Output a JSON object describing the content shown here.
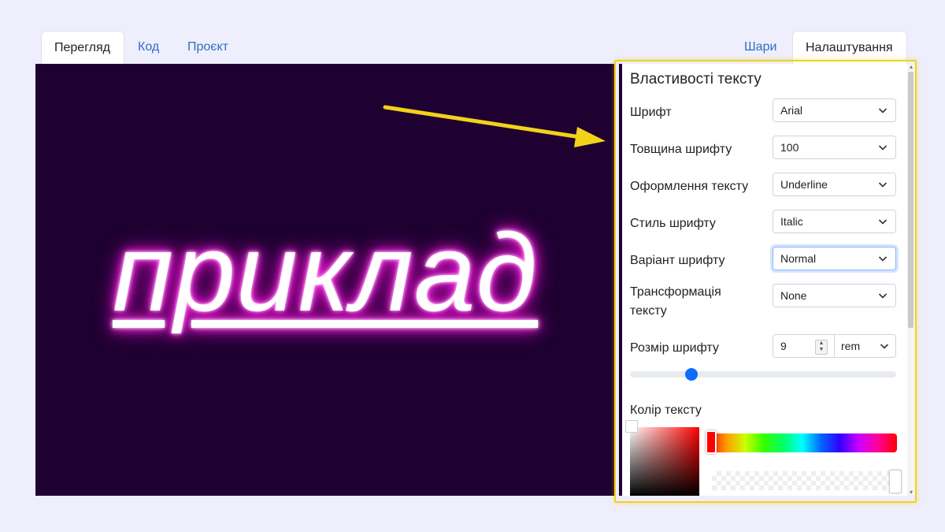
{
  "tabs_left": [
    {
      "label": "Перегляд",
      "active": true
    },
    {
      "label": "Код",
      "active": false
    },
    {
      "label": "Проєкт",
      "active": false
    }
  ],
  "tabs_right": [
    {
      "label": "Шари",
      "active": false
    },
    {
      "label": "Налаштування",
      "active": true
    }
  ],
  "preview": {
    "text": "приклад",
    "background": "#1e0130",
    "glow_color": "#ff1ad9"
  },
  "panel": {
    "title": "Властивості тексту",
    "rows": [
      {
        "label": "Шрифт",
        "value": "Arial"
      },
      {
        "label": "Товщина шрифту",
        "value": "100"
      },
      {
        "label": "Оформлення тексту",
        "value": "Underline"
      },
      {
        "label": "Стиль шрифту",
        "value": "Italic"
      },
      {
        "label": "Варіант шрифту",
        "value": "Normal",
        "focused": true
      },
      {
        "label_line1": "Трансформація",
        "label_line2": "тексту",
        "value": "None"
      }
    ],
    "font_size": {
      "label": "Розмір шрифту",
      "value": "9",
      "unit": "rem",
      "slider_fraction": 0.23
    },
    "color": {
      "label": "Колір тексту",
      "hue": "#ff0000"
    }
  },
  "highlight_color": "#f2d21b",
  "arrow_color": "#f2d21b"
}
